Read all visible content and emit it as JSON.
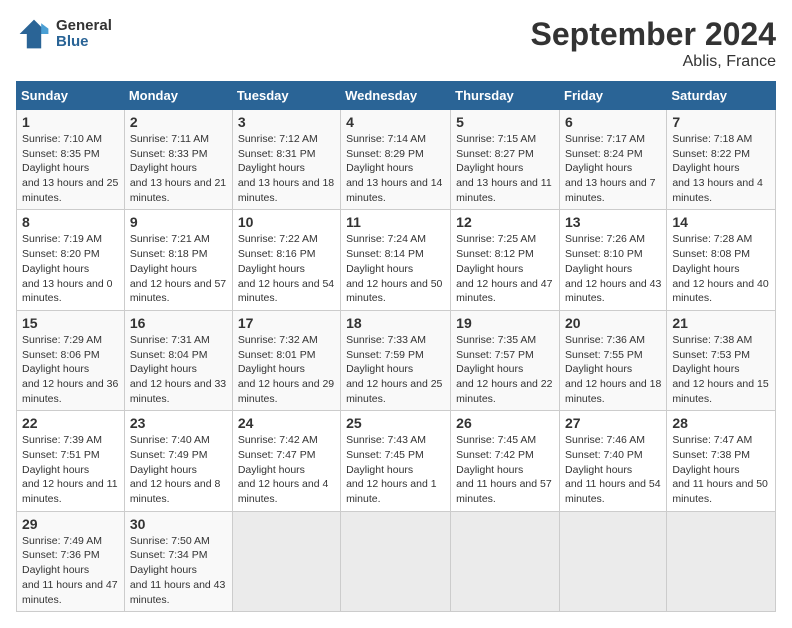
{
  "logo": {
    "text1": "General",
    "text2": "Blue"
  },
  "title": "September 2024",
  "location": "Ablis, France",
  "days_of_week": [
    "Sunday",
    "Monday",
    "Tuesday",
    "Wednesday",
    "Thursday",
    "Friday",
    "Saturday"
  ],
  "weeks": [
    [
      {
        "num": "1",
        "sunrise": "7:10 AM",
        "sunset": "8:35 PM",
        "daylight": "13 hours and 25 minutes."
      },
      {
        "num": "2",
        "sunrise": "7:11 AM",
        "sunset": "8:33 PM",
        "daylight": "13 hours and 21 minutes."
      },
      {
        "num": "3",
        "sunrise": "7:12 AM",
        "sunset": "8:31 PM",
        "daylight": "13 hours and 18 minutes."
      },
      {
        "num": "4",
        "sunrise": "7:14 AM",
        "sunset": "8:29 PM",
        "daylight": "13 hours and 14 minutes."
      },
      {
        "num": "5",
        "sunrise": "7:15 AM",
        "sunset": "8:27 PM",
        "daylight": "13 hours and 11 minutes."
      },
      {
        "num": "6",
        "sunrise": "7:17 AM",
        "sunset": "8:24 PM",
        "daylight": "13 hours and 7 minutes."
      },
      {
        "num": "7",
        "sunrise": "7:18 AM",
        "sunset": "8:22 PM",
        "daylight": "13 hours and 4 minutes."
      }
    ],
    [
      {
        "num": "8",
        "sunrise": "7:19 AM",
        "sunset": "8:20 PM",
        "daylight": "13 hours and 0 minutes."
      },
      {
        "num": "9",
        "sunrise": "7:21 AM",
        "sunset": "8:18 PM",
        "daylight": "12 hours and 57 minutes."
      },
      {
        "num": "10",
        "sunrise": "7:22 AM",
        "sunset": "8:16 PM",
        "daylight": "12 hours and 54 minutes."
      },
      {
        "num": "11",
        "sunrise": "7:24 AM",
        "sunset": "8:14 PM",
        "daylight": "12 hours and 50 minutes."
      },
      {
        "num": "12",
        "sunrise": "7:25 AM",
        "sunset": "8:12 PM",
        "daylight": "12 hours and 47 minutes."
      },
      {
        "num": "13",
        "sunrise": "7:26 AM",
        "sunset": "8:10 PM",
        "daylight": "12 hours and 43 minutes."
      },
      {
        "num": "14",
        "sunrise": "7:28 AM",
        "sunset": "8:08 PM",
        "daylight": "12 hours and 40 minutes."
      }
    ],
    [
      {
        "num": "15",
        "sunrise": "7:29 AM",
        "sunset": "8:06 PM",
        "daylight": "12 hours and 36 minutes."
      },
      {
        "num": "16",
        "sunrise": "7:31 AM",
        "sunset": "8:04 PM",
        "daylight": "12 hours and 33 minutes."
      },
      {
        "num": "17",
        "sunrise": "7:32 AM",
        "sunset": "8:01 PM",
        "daylight": "12 hours and 29 minutes."
      },
      {
        "num": "18",
        "sunrise": "7:33 AM",
        "sunset": "7:59 PM",
        "daylight": "12 hours and 25 minutes."
      },
      {
        "num": "19",
        "sunrise": "7:35 AM",
        "sunset": "7:57 PM",
        "daylight": "12 hours and 22 minutes."
      },
      {
        "num": "20",
        "sunrise": "7:36 AM",
        "sunset": "7:55 PM",
        "daylight": "12 hours and 18 minutes."
      },
      {
        "num": "21",
        "sunrise": "7:38 AM",
        "sunset": "7:53 PM",
        "daylight": "12 hours and 15 minutes."
      }
    ],
    [
      {
        "num": "22",
        "sunrise": "7:39 AM",
        "sunset": "7:51 PM",
        "daylight": "12 hours and 11 minutes."
      },
      {
        "num": "23",
        "sunrise": "7:40 AM",
        "sunset": "7:49 PM",
        "daylight": "12 hours and 8 minutes."
      },
      {
        "num": "24",
        "sunrise": "7:42 AM",
        "sunset": "7:47 PM",
        "daylight": "12 hours and 4 minutes."
      },
      {
        "num": "25",
        "sunrise": "7:43 AM",
        "sunset": "7:45 PM",
        "daylight": "12 hours and 1 minute."
      },
      {
        "num": "26",
        "sunrise": "7:45 AM",
        "sunset": "7:42 PM",
        "daylight": "11 hours and 57 minutes."
      },
      {
        "num": "27",
        "sunrise": "7:46 AM",
        "sunset": "7:40 PM",
        "daylight": "11 hours and 54 minutes."
      },
      {
        "num": "28",
        "sunrise": "7:47 AM",
        "sunset": "7:38 PM",
        "daylight": "11 hours and 50 minutes."
      }
    ],
    [
      {
        "num": "29",
        "sunrise": "7:49 AM",
        "sunset": "7:36 PM",
        "daylight": "11 hours and 47 minutes."
      },
      {
        "num": "30",
        "sunrise": "7:50 AM",
        "sunset": "7:34 PM",
        "daylight": "11 hours and 43 minutes."
      },
      null,
      null,
      null,
      null,
      null
    ]
  ]
}
